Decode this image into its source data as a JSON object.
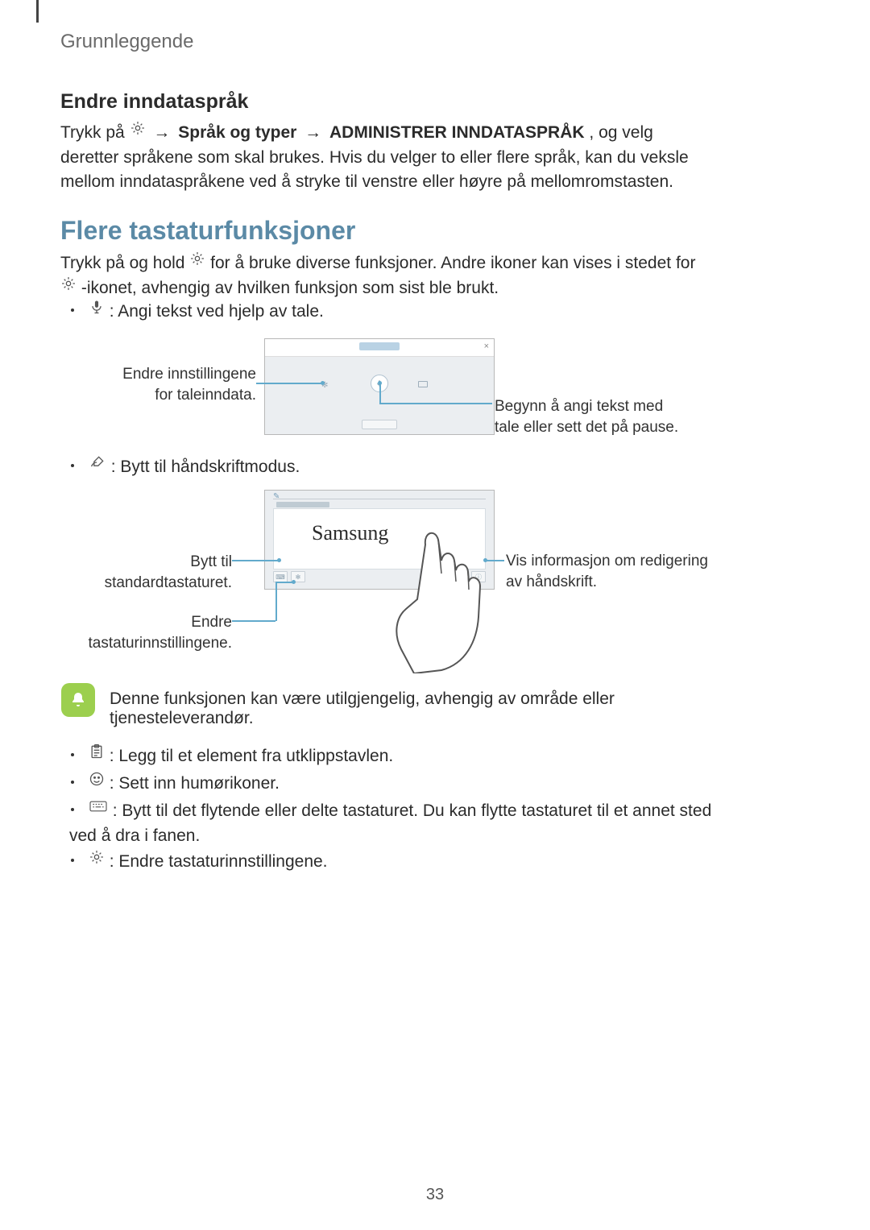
{
  "header": "Grunnleggende",
  "sec1": {
    "title": "Endre inndataspråk",
    "p1a": "Trykk på ",
    "p1b": " → ",
    "p1c": "Språk og typer",
    "p1d": " → ",
    "p1e": "ADMINISTRER INNDATASPRÅK",
    "p1f": ", og velg deretter språkene som skal brukes. Hvis du velger to eller flere språk, kan du veksle mellom inndataspråkene ved å stryke til venstre eller høyre på mellomromstasten."
  },
  "sec2": {
    "title": "Flere tastaturfunksjoner",
    "p1a": "Trykk på og hold ",
    "p1b": " for å bruke diverse funksjoner. Andre ikoner kan vises i stedet for ",
    "p1c": "-ikonet, avhengig av hvilken funksjon som sist ble brukt."
  },
  "bullets": {
    "mic": " : Angi tekst ved hjelp av tale.",
    "pen": " : Bytt til håndskriftmodus.",
    "clip": " : Legg til et element fra utklippstavlen.",
    "emoji": " : Sett inn humørikoner.",
    "float": " : Bytt til det flytende eller delte tastaturet. Du kan flytte tastaturet til et annet sted ved å dra i fanen.",
    "gear": " : Endre tastaturinnstillingene."
  },
  "diagram1": {
    "left": "Endre innstillingene for taleinndata.",
    "right": "Begynn å angi tekst med tale eller sett det på pause."
  },
  "diagram2": {
    "samsung": "Samsung",
    "left1": "Bytt til standardtastaturet.",
    "left2": "Endre tastaturinnstillingene.",
    "right": "Vis informasjon om redigering av håndskrift."
  },
  "note": "Denne funksjonen kan være utilgjengelig, avhengig av område eller tjenesteleverandør.",
  "page": "33"
}
